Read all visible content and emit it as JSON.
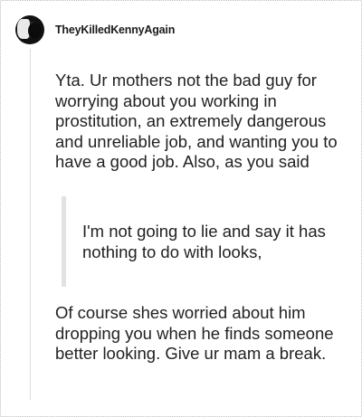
{
  "comment": {
    "author": "TheyKilledKennyAgain",
    "paragraph1": "Yta. Ur mothers not the bad guy for worrying about you working in prostitution, an extremely dangerous and unreliable job, and wanting you to have a good job. Also, as you said",
    "quote": "I'm not going to lie and say it has nothing to do with looks,",
    "paragraph2": "Of course shes worried about him dropping you when he finds someone better looking. Give ur mam a break."
  },
  "icons": {
    "avatar": "user-avatar-image"
  },
  "colors": {
    "thread_line": "#dddddd",
    "quote_bar": "#e2e2e2",
    "text": "#222222"
  }
}
